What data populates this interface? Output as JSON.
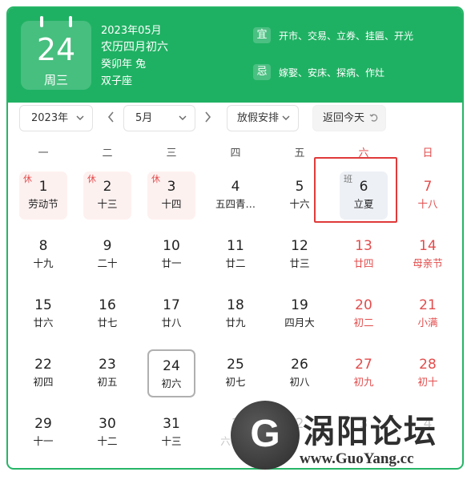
{
  "header": {
    "day": "24",
    "weekday": "周三",
    "year_month": "2023年05月",
    "lunar": "农历四月初六",
    "ganzhi": "癸卯年 兔",
    "constellation": "双子座",
    "yi_label": "宜",
    "yi_text": "开市、交易、立券、挂匾、开光",
    "ji_label": "忌",
    "ji_text": "嫁娶、安床、探病、作灶"
  },
  "controls": {
    "year": "2023年",
    "month": "5月",
    "holiday": "放假安排",
    "today": "返回今天",
    "prev_icon": "chevron-left-icon",
    "next_icon": "chevron-right-icon",
    "dropdown_icon": "chevron-down-icon",
    "refresh_icon": "return-icon"
  },
  "weekdays": [
    "一",
    "二",
    "三",
    "四",
    "五",
    "六",
    "日"
  ],
  "weeks": [
    [
      {
        "d": "1",
        "l": "劳动节",
        "badge": "休",
        "type": "rest"
      },
      {
        "d": "2",
        "l": "十三",
        "badge": "休",
        "type": "rest"
      },
      {
        "d": "3",
        "l": "十四",
        "badge": "休",
        "type": "rest"
      },
      {
        "d": "4",
        "l": "五四青…"
      },
      {
        "d": "5",
        "l": "十六"
      },
      {
        "d": "6",
        "l": "立夏",
        "badge": "班",
        "type": "work"
      },
      {
        "d": "7",
        "l": "十八",
        "red": true
      }
    ],
    [
      {
        "d": "8",
        "l": "十九"
      },
      {
        "d": "9",
        "l": "二十"
      },
      {
        "d": "10",
        "l": "廿一"
      },
      {
        "d": "11",
        "l": "廿二"
      },
      {
        "d": "12",
        "l": "廿三"
      },
      {
        "d": "13",
        "l": "廿四",
        "red": true
      },
      {
        "d": "14",
        "l": "母亲节",
        "red": true
      }
    ],
    [
      {
        "d": "15",
        "l": "廿六"
      },
      {
        "d": "16",
        "l": "廿七"
      },
      {
        "d": "17",
        "l": "廿八"
      },
      {
        "d": "18",
        "l": "廿九"
      },
      {
        "d": "19",
        "l": "四月大"
      },
      {
        "d": "20",
        "l": "初二",
        "red": true
      },
      {
        "d": "21",
        "l": "小满",
        "red": true
      }
    ],
    [
      {
        "d": "22",
        "l": "初四"
      },
      {
        "d": "23",
        "l": "初五"
      },
      {
        "d": "24",
        "l": "初六",
        "today": true
      },
      {
        "d": "25",
        "l": "初七"
      },
      {
        "d": "26",
        "l": "初八"
      },
      {
        "d": "27",
        "l": "初九",
        "red": true
      },
      {
        "d": "28",
        "l": "初十",
        "red": true
      }
    ],
    [
      {
        "d": "29",
        "l": "十一"
      },
      {
        "d": "30",
        "l": "十二"
      },
      {
        "d": "31",
        "l": "十三"
      },
      {
        "d": "1",
        "l": "六一…",
        "faded": true
      },
      {
        "d": "2",
        "l": "",
        "faded": true
      },
      {
        "d": "3",
        "l": "",
        "faded": true
      },
      {
        "d": "4",
        "l": "",
        "faded": true
      }
    ]
  ],
  "watermark": {
    "title": "涡阳论坛",
    "url": "www.GuoYang.cc"
  },
  "colors": {
    "accent": "#1fb163",
    "weekend": "#e34c4c",
    "highlight_box": "#e03a3a"
  }
}
